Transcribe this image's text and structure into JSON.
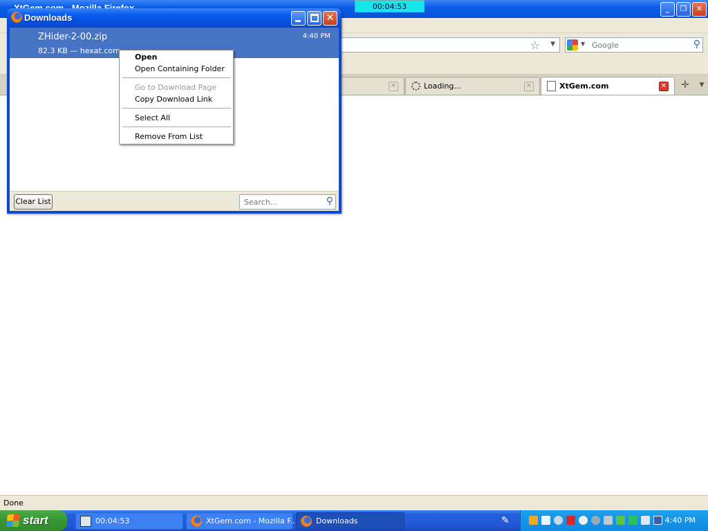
{
  "firefox": {
    "title": "XtGem.com - Mozilla Firefox",
    "search_placeholder": "Google",
    "tabs": [
      {
        "label": ""
      },
      {
        "label": "Loading..."
      },
      {
        "label": "XtGem.com"
      }
    ],
    "status": "Done"
  },
  "timer_overlay": "00:04:53",
  "downloads": {
    "title": "Downloads",
    "item": {
      "filename": "ZHider-2-00.zip",
      "meta": "82.3 KB — hexat.com",
      "time": "4:40 PM"
    },
    "clear_list_label": "Clear List",
    "search_placeholder": "Search..."
  },
  "context_menu": {
    "items": [
      {
        "label": "Open",
        "bold": true,
        "disabled": false
      },
      {
        "label": "Open Containing Folder",
        "bold": false,
        "disabled": false
      },
      {
        "label": "Go to Download Page",
        "bold": false,
        "disabled": true
      },
      {
        "label": "Copy Download Link",
        "bold": false,
        "disabled": false
      },
      {
        "label": "Select All",
        "bold": false,
        "disabled": false
      },
      {
        "label": "Remove From List",
        "bold": false,
        "disabled": false
      }
    ]
  },
  "taskbar": {
    "start_label": "start",
    "buttons": [
      {
        "label": "00:04:53"
      },
      {
        "label": "XtGem.com - Mozilla F..."
      },
      {
        "label": "Downloads"
      }
    ],
    "clock": "4:40 PM"
  },
  "colors": {
    "xp_blue": "#0a5ef0",
    "download_item_selected": "#4773c5",
    "timer_overlay_bg": "#16e5ea",
    "start_green": "#3a9a36",
    "tray_blue": "#1ba0ec"
  },
  "icons": {
    "firefox": "firefox-icon",
    "bookmark": "star-icon",
    "search": "magnifier-icon",
    "search_engine": "google-icon",
    "tab_loading": "loading-spinner-icon",
    "tab_page": "page-icon",
    "new_tab": "plus-icon",
    "tab_list": "chevron-down-icon",
    "start": "windows-logo-icon"
  }
}
